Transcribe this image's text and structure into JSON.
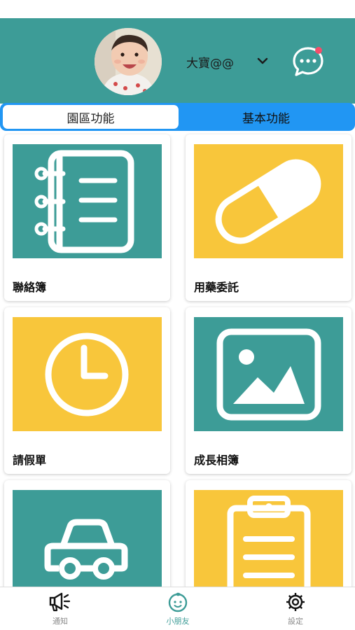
{
  "header": {
    "child_name": "大寶@@",
    "avatar_icon": "child-photo",
    "dropdown_icon": "chevron-down-icon",
    "message_icon": "chat-bubble-icon",
    "has_unread": true,
    "color": "#3d9c97"
  },
  "tabs": [
    {
      "label": "園區功能",
      "selected": true
    },
    {
      "label": "基本功能",
      "selected": false
    }
  ],
  "cards": [
    {
      "label": "聯絡簿",
      "icon": "notebook-icon",
      "color": "#3d9c97"
    },
    {
      "label": "用藥委託",
      "icon": "pill-icon",
      "color": "#f8c63b"
    },
    {
      "label": "請假單",
      "icon": "clock-icon",
      "color": "#f8c63b"
    },
    {
      "label": "成長相簿",
      "icon": "photo-album-icon",
      "color": "#3d9c97"
    },
    {
      "label": "",
      "icon": "car-icon",
      "color": "#3d9c97"
    },
    {
      "label": "",
      "icon": "clipboard-icon",
      "color": "#f8c63b"
    }
  ],
  "bottom_nav": [
    {
      "label": "通知",
      "icon": "megaphone-icon",
      "active": false
    },
    {
      "label": "小朋友",
      "icon": "baby-face-icon",
      "active": true
    },
    {
      "label": "設定",
      "icon": "gear-icon",
      "active": false
    }
  ],
  "colors": {
    "teal": "#3d9c97",
    "yellow": "#f8c63b",
    "tab_blue": "#2196f3",
    "badge": "#f44e6b"
  }
}
